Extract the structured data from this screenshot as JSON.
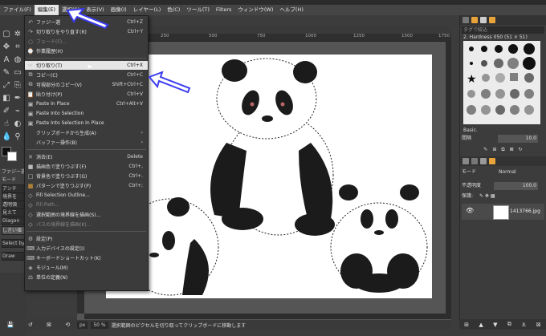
{
  "menubar": {
    "items": [
      "ファイル(F)",
      "編集(E)",
      "選択(S)",
      "表示(V)",
      "画像(I)",
      "レイヤー(L)",
      "色(C)",
      "ツール(T)",
      "Filters",
      "ウィンドウ(W)",
      "ヘルプ(H)"
    ],
    "active_index": 1
  },
  "edit_menu": {
    "items": [
      {
        "label": "ファジー選",
        "shortcut": "Ctrl+Z",
        "icon": "undo-icon"
      },
      {
        "label": "切り取りをやり直す(R)",
        "shortcut": "Ctrl+Y",
        "icon": "redo-icon"
      },
      {
        "label": "フェード(F)...",
        "shortcut": "",
        "icon": "fade-icon",
        "disabled": true
      },
      {
        "label": "作業履歴(H)",
        "shortcut": "",
        "icon": "history-icon"
      },
      {
        "label": "切り取り(T)",
        "shortcut": "Ctrl+X",
        "icon": "cut-icon",
        "highlighted": true
      },
      {
        "label": "コピー(C)",
        "shortcut": "Ctrl+C",
        "icon": "copy-icon"
      },
      {
        "label": "可視部分のコピー(V)",
        "shortcut": "Shift+Ctrl+C",
        "icon": "copy-visible-icon"
      },
      {
        "label": "貼り付け(P)",
        "shortcut": "Ctrl+V",
        "icon": "paste-icon"
      },
      {
        "label": "Paste In Place",
        "shortcut": "Ctrl+Alt+V",
        "icon": "paste-in-place-icon"
      },
      {
        "label": "Paste Into Selection",
        "shortcut": "",
        "icon": "paste-into-icon"
      },
      {
        "label": "Paste Into Selection In Place",
        "shortcut": "",
        "icon": "paste-into-place-icon"
      },
      {
        "label": "クリップボードから生成(A)",
        "shortcut": "",
        "icon": "",
        "submenu": true
      },
      {
        "label": "バッファー操作(B)",
        "shortcut": "",
        "icon": "",
        "submenu": true
      },
      {
        "label": "消去(E)",
        "shortcut": "Delete",
        "icon": "clear-icon"
      },
      {
        "label": "描画色で塗りつぶす(F)",
        "shortcut": "Ctrl+,",
        "icon": "fill-fg-icon"
      },
      {
        "label": "背景色で塗りつぶす(G)",
        "shortcut": "Ctrl+.",
        "icon": "fill-bg-icon"
      },
      {
        "label": "パターンで塗りつぶす(P)",
        "shortcut": "Ctrl+;",
        "icon": "fill-pattern-icon"
      },
      {
        "label": "Fill Selection Outline...",
        "shortcut": "",
        "icon": "fill-outline-icon"
      },
      {
        "label": "Fill Path...",
        "shortcut": "",
        "icon": "fill-path-icon",
        "disabled": true
      },
      {
        "label": "選択範囲の境界線を描画(S)...",
        "shortcut": "",
        "icon": "stroke-selection-icon"
      },
      {
        "label": "パスの境界線を描画(K)...",
        "shortcut": "",
        "icon": "stroke-path-icon",
        "disabled": true
      },
      {
        "label": "設定(P)",
        "shortcut": "",
        "icon": "preferences-icon"
      },
      {
        "label": "入力デバイスの設定(I)",
        "shortcut": "",
        "icon": "input-devices-icon"
      },
      {
        "label": "キーボードショートカット(K)",
        "shortcut": "",
        "icon": "keyboard-icon"
      },
      {
        "label": "モジュール(M)",
        "shortcut": "",
        "icon": "modules-icon"
      },
      {
        "label": "単位の定義(N)",
        "shortcut": "",
        "icon": "units-icon"
      }
    ]
  },
  "ruler": {
    "ticks": [
      "250",
      "500",
      "750",
      "1000",
      "1250",
      "1500",
      "1750"
    ]
  },
  "left_dock": {
    "rows": [
      "ファジー選",
      "モード",
      "アンチ",
      "境界を",
      "透明領",
      "見えて",
      "Diagon",
      "しきい値",
      "Select by",
      "Draw"
    ]
  },
  "statusbar": {
    "unit": "px",
    "zoom": "50 %",
    "message": "選択範囲のピクセルを切り取ってクリップボードに移動します"
  },
  "right_dock": {
    "filter_placeholder": "タグで絞込",
    "brush_name": "2. Hardness 050 (51 × 51)",
    "preset": "Basic.",
    "spacing_label": "間隔",
    "spacing_value": "10.0",
    "mode_label": "モード",
    "mode_value": "Normal",
    "opacity_label": "不透明度",
    "opacity_value": "100.0",
    "lock_label": "保護:",
    "layer_name": "1413766.jpg"
  },
  "colors": {
    "accent_orange": "#e8a33a",
    "highlight": "#e6e6e6",
    "arrow_blue": "#3b3bf0"
  }
}
